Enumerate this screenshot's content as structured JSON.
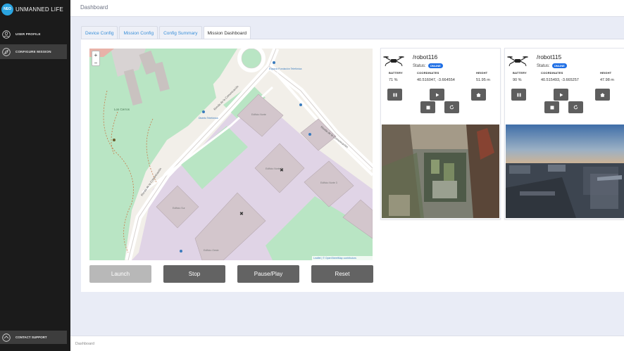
{
  "app": {
    "logo_text": "NEO",
    "name": "UNMANNED LIFE"
  },
  "sidebar": {
    "items": [
      {
        "label": "USER PROFILE",
        "icon": "user-icon",
        "active": false
      },
      {
        "label": "CONFIGURE MISSION",
        "icon": "compass-icon",
        "active": true
      }
    ],
    "support_label": "CONTACT SUPPORT"
  },
  "header": {
    "title": "Dashboard"
  },
  "tabs": [
    {
      "label": "Device Config",
      "active": false
    },
    {
      "label": "Mission Config",
      "active": false
    },
    {
      "label": "Config Summary",
      "active": false
    },
    {
      "label": "Mission Dashboard",
      "active": true
    }
  ],
  "map": {
    "zoom_in": "+",
    "zoom_out": "−",
    "attribution": "Leaflet | © OpenStreetMap contributors",
    "street_1": "Ronda de la Comunicación",
    "street_2": "Ronda de la Comunicación",
    "street_3": "Ronda de la Comunicación",
    "park_label": "Los Cerros",
    "building_1": "Edificio Norte",
    "building_2": "Edificio Norte 2",
    "building_3": "Edificio Sur",
    "building_4": "Edificio Norte 3",
    "building_5": "Edificio Oeste",
    "poi_1": "Distrito Telefónica",
    "poi_2": "Espacio Fundación Telefónica",
    "colors": {
      "park": "#b9e5c4",
      "campus": "#e0d4e6",
      "building": "#d3c6cc",
      "road": "#ffffff"
    }
  },
  "controls": {
    "launch": "Launch",
    "stop": "Stop",
    "pause_play": "Pause/Play",
    "reset": "Reset"
  },
  "stat_headers": {
    "battery": "BATTERY",
    "coordinates": "COORDINATES",
    "height": "HEIGHT"
  },
  "robots": [
    {
      "name": "/robot116",
      "status_label": "Status:",
      "status": "ONLINE",
      "battery": "71 %",
      "coordinates": "40.516047, -3.664554",
      "height": "51.95 m"
    },
    {
      "name": "/robot115",
      "status_label": "Status:",
      "status": "ONLINE",
      "battery": "90 %",
      "coordinates": "40.515493, -3.665257",
      "height": "47.98 m"
    }
  ],
  "footer": {
    "text": "Dashboard"
  },
  "colors": {
    "accent": "#2aa4e0",
    "badge": "#1f6fe5",
    "button": "#636363",
    "sidebar": "#1b1b1b"
  }
}
